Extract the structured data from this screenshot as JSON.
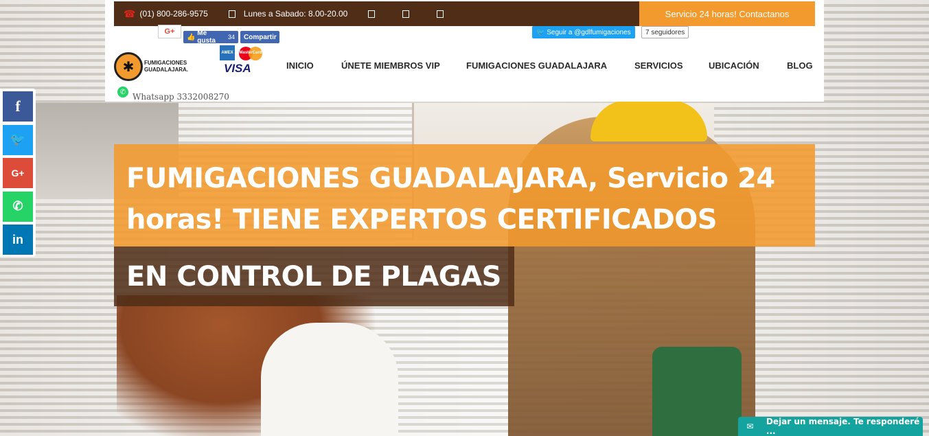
{
  "topbar": {
    "phone": "(01) 800-286-9575",
    "hours": "Lunes a Sabado: 8.00-20.00",
    "cta_label": "Servicio 24 horas! Contactanos"
  },
  "social_widgets": {
    "gplus": "G+",
    "fb_like_label": "Me gusta",
    "fb_like_count": "34",
    "fb_share_label": "Compartir",
    "twitter_follow": "Seguir a @gdlfumigaciones",
    "twitter_followers": "7 seguidores"
  },
  "logo": {
    "text": "FUMIGACIONES GUADALAJARA."
  },
  "payment": {
    "amex": "AMERICAN EXPRESS",
    "mastercard": "MasterCard",
    "visa": "VISA"
  },
  "nav": {
    "items": [
      {
        "label": "INICIO"
      },
      {
        "label": "ÚNETE MIEMBROS VIP"
      },
      {
        "label": "FUMIGACIONES GUADALAJARA"
      },
      {
        "label": "SERVICIOS"
      },
      {
        "label": "UBICACIÓN"
      },
      {
        "label": "BLOG"
      }
    ]
  },
  "whatsapp": {
    "text": "Whatsapp 3332008270"
  },
  "share_bar": {
    "facebook": "f",
    "twitter": "🐦",
    "google_plus": "G+",
    "whatsapp": "✆",
    "linkedin": "in"
  },
  "hero": {
    "headline_line1": "FUMIGACIONES GUADALAJARA, Servicio 24 horas! TIENE EXPERTOS CERTIFICADOS",
    "headline_line2": "EN CONTROL DE PLAGAS"
  },
  "chat": {
    "label": "Dejar un mensaje. Te responderé ..."
  },
  "colors": {
    "orange": "#f29a2e",
    "brown": "#4f2d17",
    "chat_teal": "#15a3a0"
  }
}
